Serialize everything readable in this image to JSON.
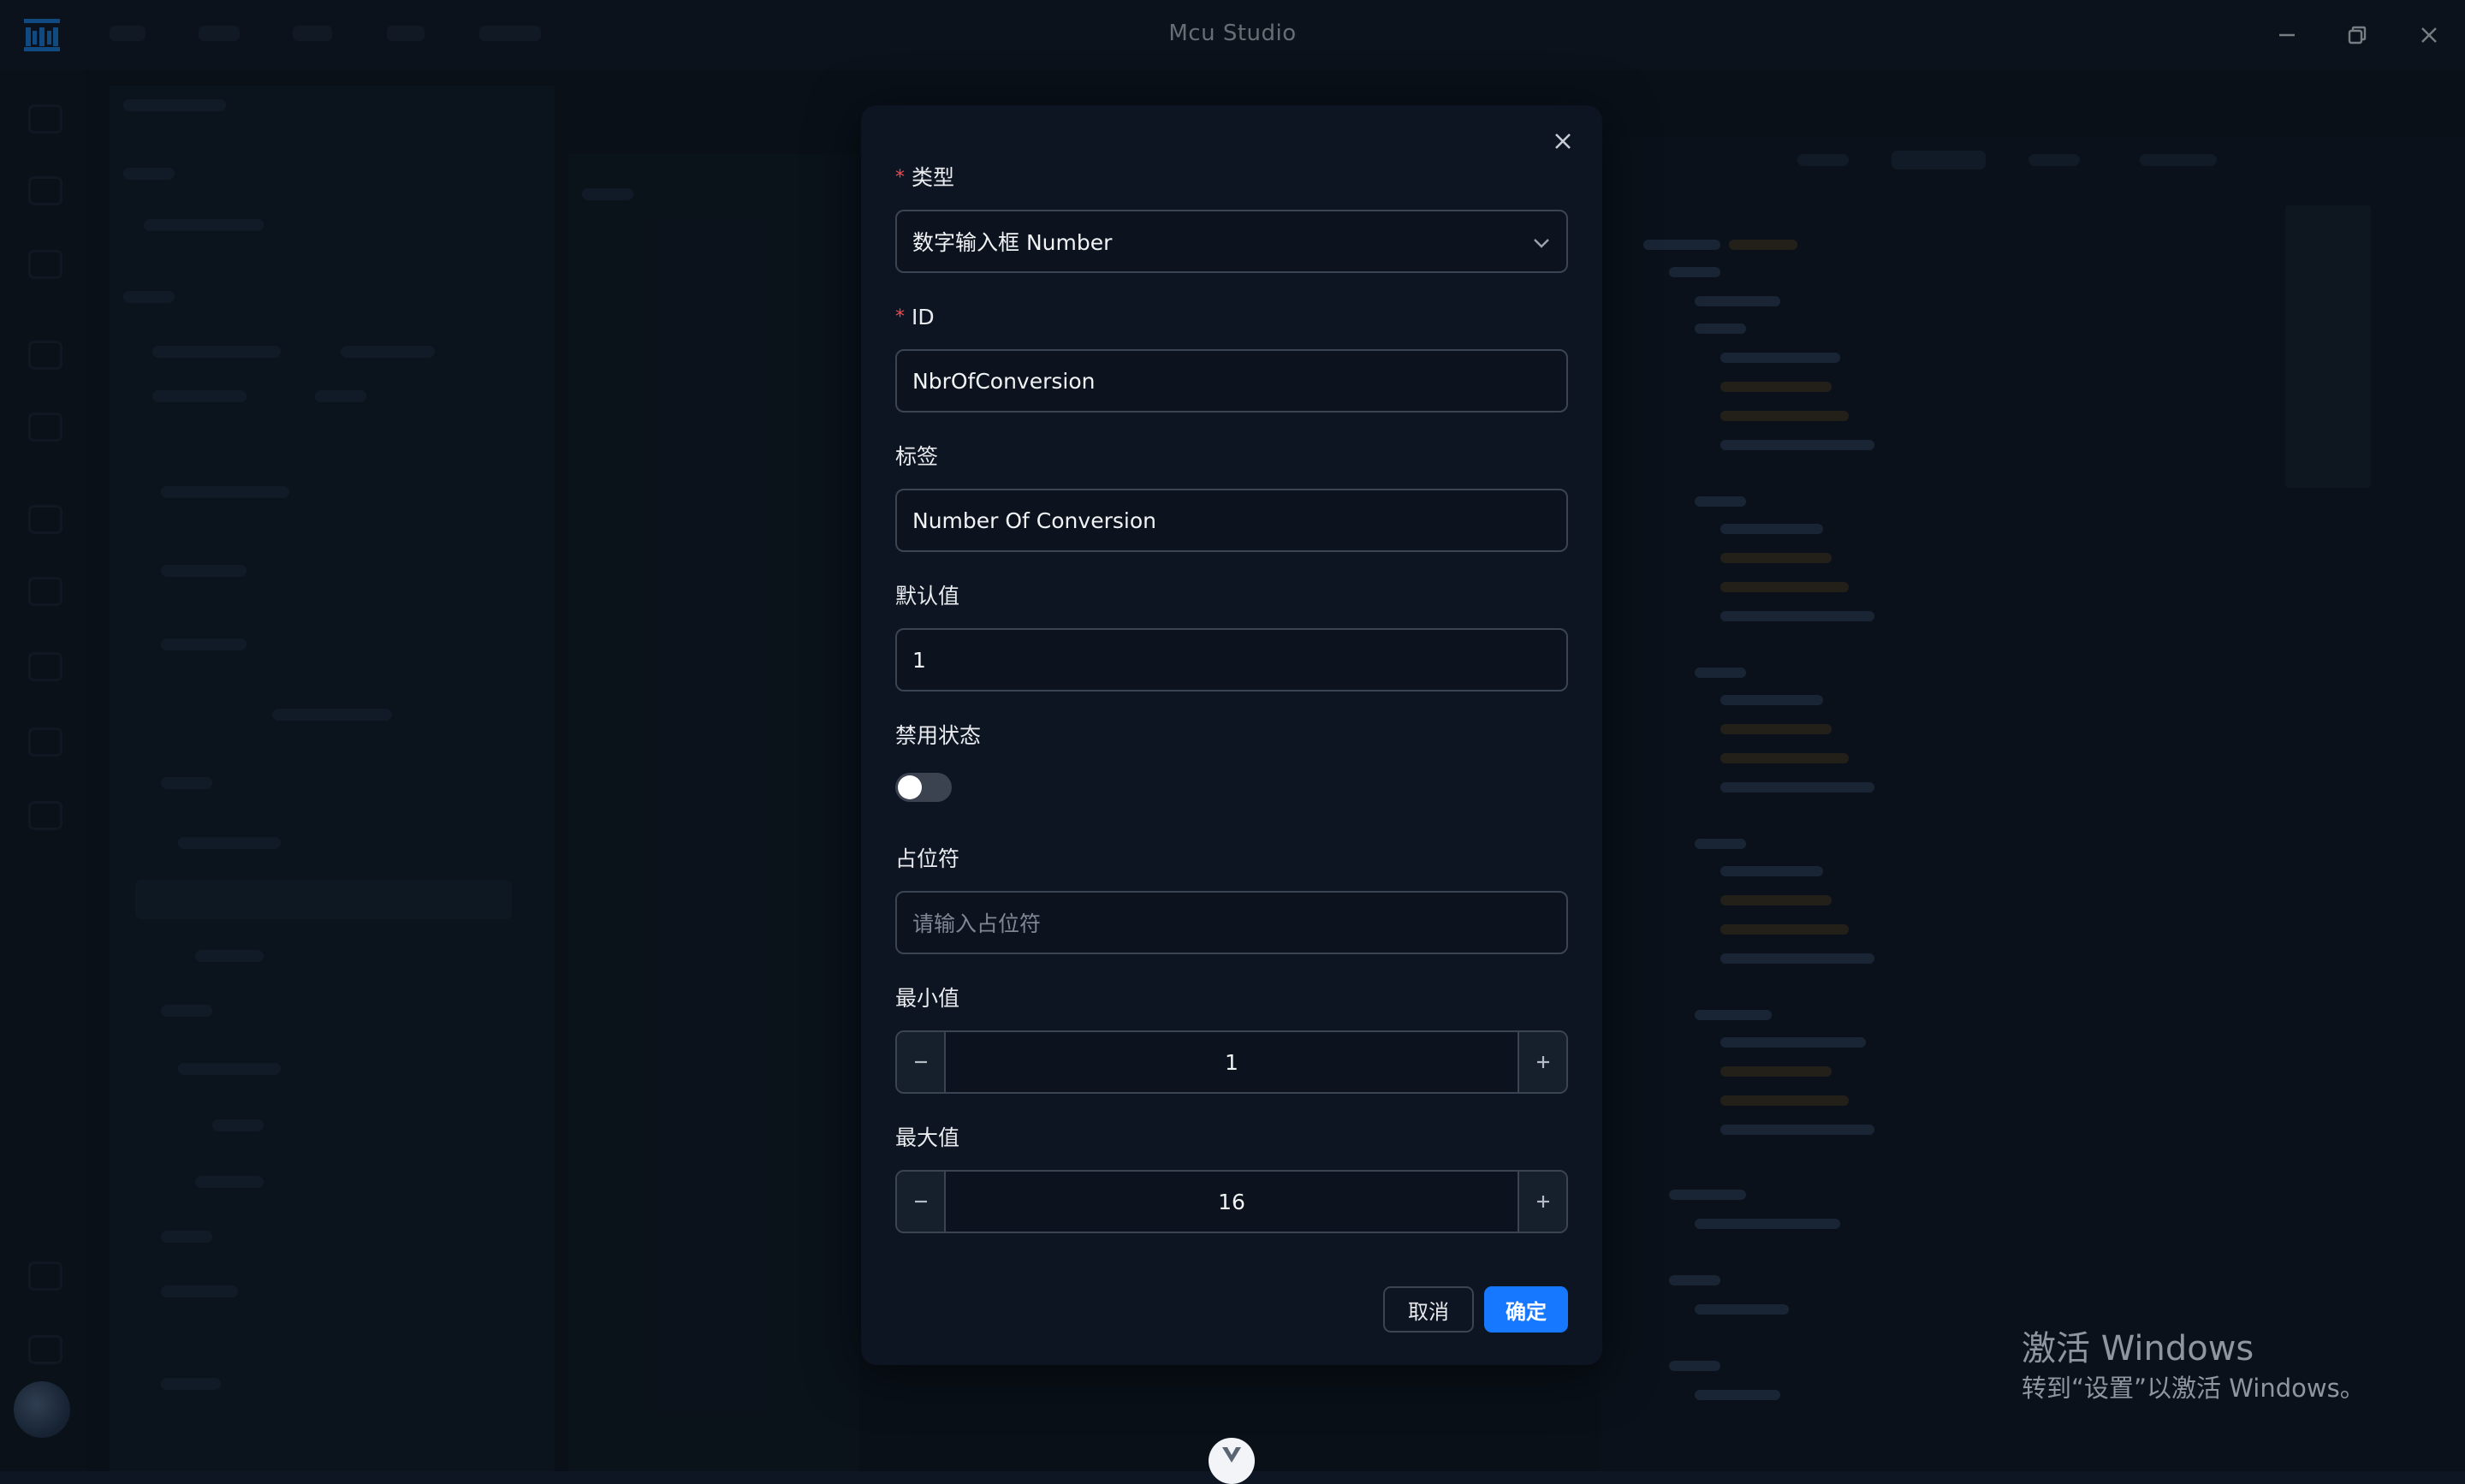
{
  "window": {
    "title": "Mcu Studio",
    "minimize_icon": "minimize-icon",
    "maximize_icon": "restore-icon",
    "close_icon": "close-icon"
  },
  "modal": {
    "fields": {
      "type": {
        "label": "类型",
        "required": true,
        "value": "数字输入框 Number"
      },
      "id": {
        "label": "ID",
        "required": true,
        "value": "NbrOfConversion"
      },
      "tag": {
        "label": "标签",
        "value": "Number Of Conversion"
      },
      "default": {
        "label": "默认值",
        "value": "1"
      },
      "disabled": {
        "label": "禁用状态",
        "checked": false
      },
      "placeholder": {
        "label": "占位符",
        "value": "",
        "placeholder": "请输入占位符"
      },
      "min": {
        "label": "最小值",
        "value": "1"
      },
      "max": {
        "label": "最大值",
        "value": "16"
      }
    },
    "buttons": {
      "cancel": "取消",
      "ok": "确定"
    }
  },
  "watermark": {
    "line1": "激活 Windows",
    "line2": "转到“设置”以激活 Windows。"
  },
  "colors": {
    "accent": "#1677ff",
    "required_mark": "#f5484b",
    "background": "#0d1622"
  }
}
